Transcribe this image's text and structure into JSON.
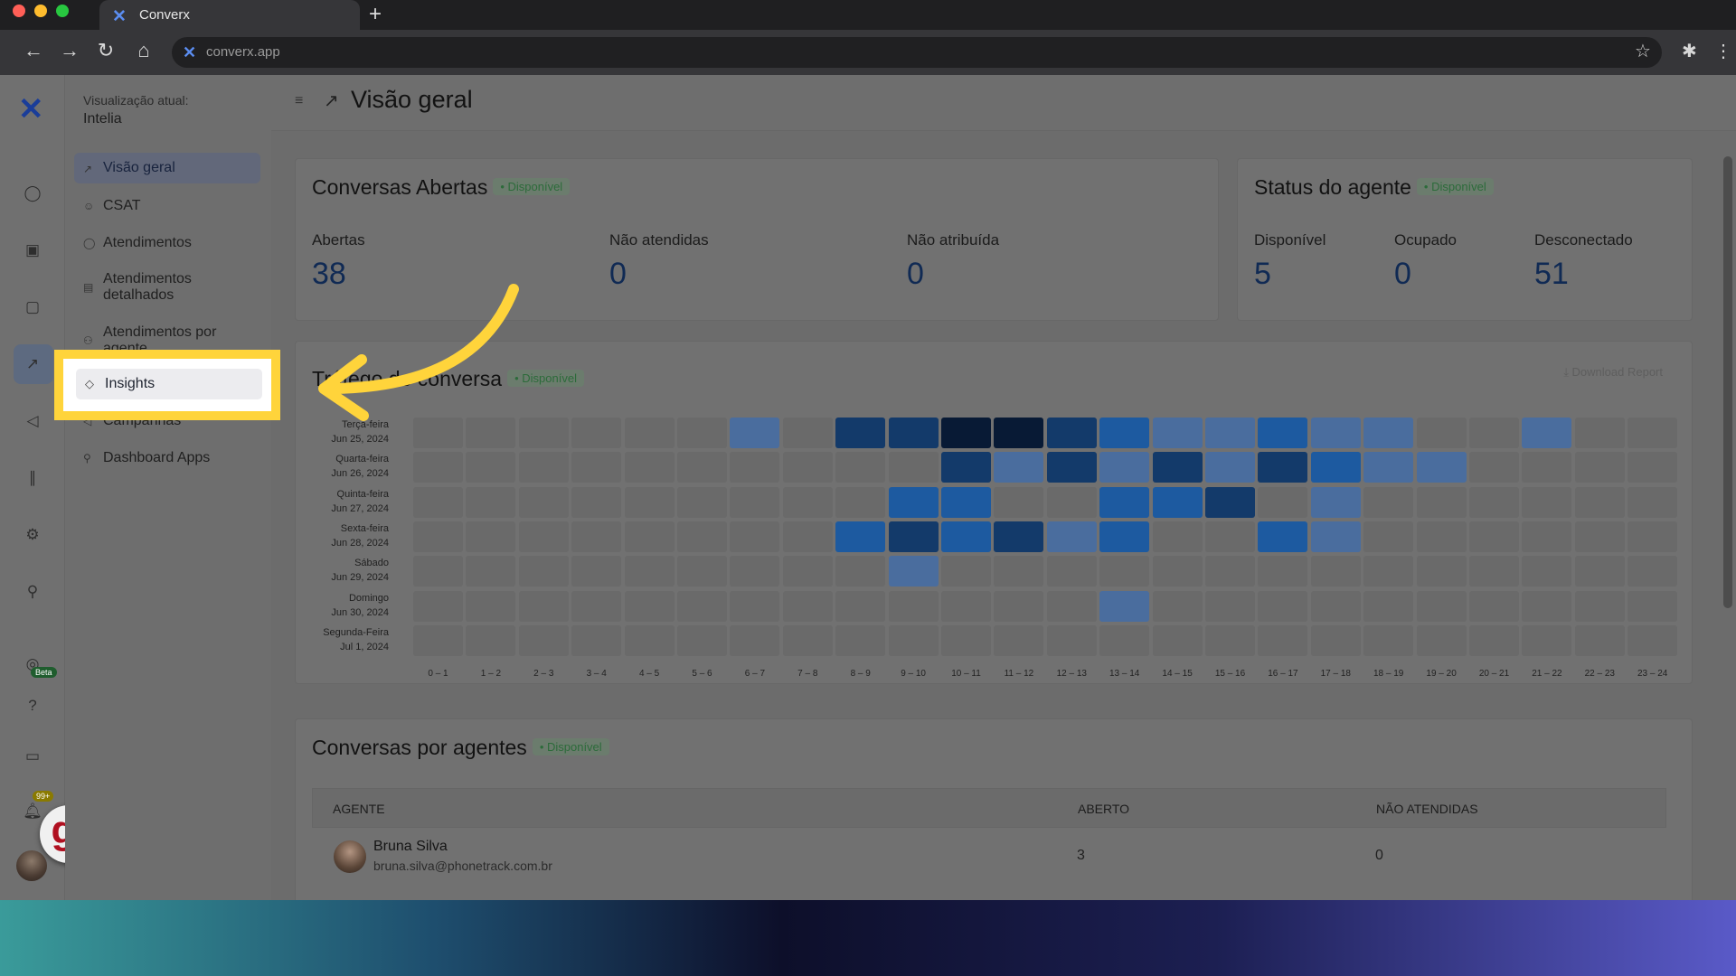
{
  "browser": {
    "tab_title": "Converx",
    "url": "converx.app"
  },
  "sidebar": {
    "view_label": "Visualização atual:",
    "view_value": "Intelia",
    "items": [
      {
        "label": "Visão geral",
        "icon": "chart-icon",
        "active": true
      },
      {
        "label": "CSAT",
        "icon": "smile-icon"
      },
      {
        "label": "Atendimentos",
        "icon": "chat-icon"
      },
      {
        "label": "Atendimentos detalhados",
        "icon": "table-icon"
      },
      {
        "label": "Atendimentos por agente",
        "icon": "people-icon"
      },
      {
        "label": "Insights",
        "icon": "tag-icon",
        "highlighted": true
      },
      {
        "label": "Campanhas",
        "icon": "megaphone-icon"
      },
      {
        "label": "Dashboard Apps",
        "icon": "link-icon"
      }
    ]
  },
  "rail": {
    "beta": "Beta",
    "notifications": "99+",
    "logo_letter": "g."
  },
  "header": {
    "title": "Visão geral"
  },
  "open_conversations": {
    "title": "Conversas Abertas",
    "status": "• Disponível",
    "metrics": [
      {
        "label": "Abertas",
        "value": "38"
      },
      {
        "label": "Não atendidas",
        "value": "0"
      },
      {
        "label": "Não atribuída",
        "value": "0"
      }
    ]
  },
  "agent_status": {
    "title": "Status do agente",
    "status": "• Disponível",
    "metrics": [
      {
        "label": "Disponível",
        "value": "5"
      },
      {
        "label": "Ocupado",
        "value": "0"
      },
      {
        "label": "Desconectado",
        "value": "51"
      }
    ]
  },
  "traffic": {
    "title": "Tráfego de conversa",
    "status": "• Disponível",
    "download": "Download Report",
    "days": [
      {
        "day": "Terça-feira",
        "date": "Jun 25, 2024"
      },
      {
        "day": "Quarta-feira",
        "date": "Jun 26, 2024"
      },
      {
        "day": "Quinta-feira",
        "date": "Jun 27, 2024"
      },
      {
        "day": "Sexta-feira",
        "date": "Jun 28, 2024"
      },
      {
        "day": "Sábado",
        "date": "Jun 29, 2024"
      },
      {
        "day": "Domingo",
        "date": "Jun 30, 2024"
      },
      {
        "day": "Segunda-Feira",
        "date": "Jul 1, 2024"
      }
    ],
    "hours": [
      "0 – 1",
      "1 – 2",
      "2 – 3",
      "3 – 4",
      "4 – 5",
      "5 – 6",
      "6 – 7",
      "7 – 8",
      "8 – 9",
      "9 – 10",
      "10 – 11",
      "11 – 12",
      "12 – 13",
      "13 – 14",
      "14 – 15",
      "15 – 16",
      "16 – 17",
      "17 – 18",
      "18 – 19",
      "19 – 20",
      "20 – 21",
      "21 – 22",
      "22 – 23",
      "23 – 24"
    ],
    "intensity": [
      [
        0,
        0,
        0,
        0,
        0,
        0,
        2,
        0,
        4,
        4,
        5,
        5,
        4,
        3,
        2,
        2,
        3,
        2,
        2,
        0,
        0,
        2,
        0,
        0
      ],
      [
        0,
        0,
        0,
        0,
        0,
        0,
        0,
        0,
        0,
        0,
        4,
        2,
        4,
        2,
        4,
        2,
        4,
        3,
        2,
        2,
        0,
        0,
        0,
        0
      ],
      [
        0,
        0,
        0,
        0,
        0,
        0,
        0,
        0,
        0,
        3,
        3,
        0,
        0,
        3,
        3,
        4,
        0,
        2,
        0,
        0,
        0,
        0,
        0,
        0
      ],
      [
        0,
        0,
        0,
        0,
        0,
        0,
        0,
        0,
        3,
        4,
        3,
        4,
        2,
        3,
        0,
        0,
        3,
        2,
        0,
        0,
        0,
        0,
        0,
        0
      ],
      [
        0,
        0,
        0,
        0,
        0,
        0,
        0,
        0,
        0,
        2,
        0,
        0,
        0,
        0,
        0,
        0,
        0,
        0,
        0,
        0,
        0,
        0,
        0,
        0
      ],
      [
        0,
        0,
        0,
        0,
        0,
        0,
        0,
        0,
        0,
        0,
        0,
        0,
        0,
        2,
        0,
        0,
        0,
        0,
        0,
        0,
        0,
        0,
        0,
        0
      ],
      [
        0,
        0,
        0,
        0,
        0,
        0,
        0,
        0,
        0,
        0,
        0,
        0,
        0,
        0,
        0,
        0,
        0,
        0,
        0,
        0,
        0,
        0,
        0,
        0
      ]
    ],
    "colors": [
      "#6a6a6a",
      "#4f6c96",
      "#4a6d9e",
      "#1d5aa0",
      "#133a6a",
      "#081a35"
    ]
  },
  "agents": {
    "title": "Conversas por agentes",
    "status": "• Disponível",
    "columns": [
      "AGENTE",
      "ABERTO",
      "NÃO ATENDIDAS"
    ],
    "rows": [
      {
        "name": "Bruna Silva",
        "email": "bruna.silva@phonetrack.com.br",
        "open": "3",
        "unattended": "0"
      }
    ]
  }
}
